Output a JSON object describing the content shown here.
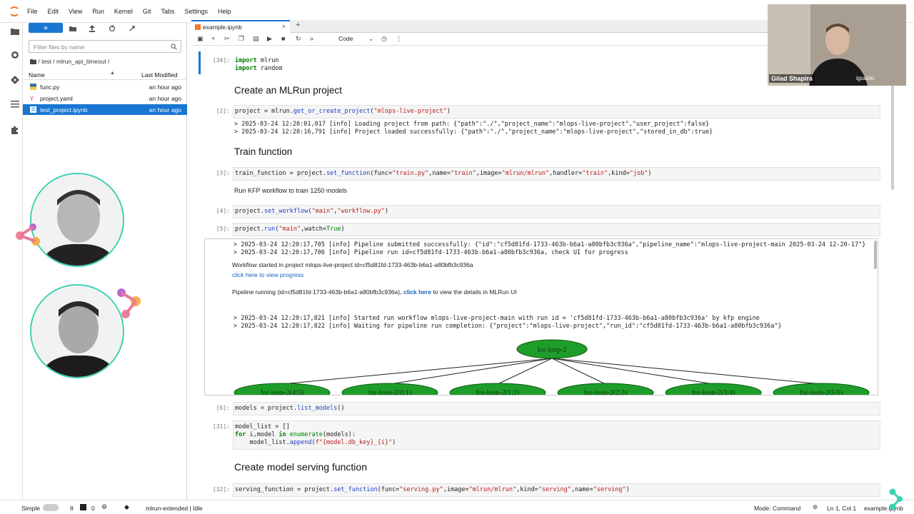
{
  "menu": [
    "File",
    "Edit",
    "View",
    "Run",
    "Kernel",
    "Git",
    "Tabs",
    "Settings",
    "Help"
  ],
  "filebrowser": {
    "new_label": "+",
    "filter_placeholder": "Filter files by name",
    "breadcrumb": "/ test / mlrun_api_timeout /",
    "col_name": "Name",
    "col_modified": "Last Modified",
    "files": [
      {
        "name": "func.py",
        "modified": "an hour ago",
        "selected": false
      },
      {
        "name": "project.yaml",
        "modified": "an hour ago",
        "selected": false
      },
      {
        "name": "test_project.ipynb",
        "modified": "an hour ago",
        "selected": true
      }
    ]
  },
  "tab": {
    "name": "example.ipynb",
    "close": "×",
    "add": "+"
  },
  "toolbar": {
    "cell_type": "Code"
  },
  "cells": {
    "c1_prompt": "[34]:",
    "c1_l1a": "import",
    "c1_l1b": " mlrun",
    "c1_l2a": "import",
    "c1_l2b": " random",
    "h1": "Create an MLRun project",
    "c2_prompt": "[2]:",
    "c2_a": "project = mlrun.",
    "c2_b": "get_or_create_project",
    "c2_c": "(",
    "c2_d": "\"mlops-live-project\"",
    "c2_e": ")",
    "c2_out1": "> 2025-03-24 12:20:01,017 [info] Loading project from path: {\"path\":\"./\",\"project_name\":\"mlops-live-project\",\"user_project\":false}",
    "c2_out2": "> 2025-03-24 12:20:16,791 [info] Project loaded successfully: {\"path\":\"./\",\"project_name\":\"mlops-live-project\",\"stored_in_db\":true}",
    "h2": "Train function",
    "c3_prompt": "[3]:",
    "c3_a": "train_function = project.",
    "c3_b": "set_function",
    "c3_c": "(func=",
    "c3_d": "\"train.py\"",
    "c3_e": ",name=",
    "c3_f": "\"train\"",
    "c3_g": ",image=",
    "c3_h": "\"mlrun/mlrun\"",
    "c3_i": ",handler=",
    "c3_j": "\"train\"",
    "c3_k": ",kind=",
    "c3_l": "\"job\"",
    "c3_m": ")",
    "p1": "Run KFP workflow to train 1250 models",
    "c4_prompt": "[4]:",
    "c4_a": "project.",
    "c4_b": "set_workflow",
    "c4_c": "(",
    "c4_d": "\"main\"",
    "c4_e": ",",
    "c4_f": "\"workflow.py\"",
    "c4_g": ")",
    "c5_prompt": "[5]:",
    "c5_a": "project.",
    "c5_b": "run",
    "c5_c": "(",
    "c5_d": "\"main\"",
    "c5_e": ",watch=",
    "c5_f": "True",
    "c5_g": ")",
    "c5_out1": "> 2025-03-24 12:20:17,705 [info] Pipeline submitted successfully: {\"id\":\"cf5d81fd-1733-463b-b6a1-a80bfb3c936a\",\"pipeline_name\":\"mlops-live-project-main 2025-03-24 12-20-17\"}",
    "c5_out2": "> 2025-03-24 12:20:17,706 [info] Pipeline run id=cf5d81fd-1733-463b-b6a1-a80bfb3c936a, check UI for progress",
    "c5_wf": "Workflow started in project mlops-live-project id=cf5d81fd-1733-463b-b6a1-a80bfb3c936a",
    "c5_link1": "click here to view progress",
    "c5_pr_a": "Pipeline running (id=cf5d81fd-1733-463b-b6a1-a80bfb3c936a), ",
    "c5_pr_b": "click here",
    "c5_pr_c": " to view the details in MLRun UI",
    "c5_out3": "> 2025-03-24 12:20:17,821 [info] Started run workflow mlops-live-project-main with run id = 'cf5d81fd-1733-463b-b6a1-a80bfb3c936a' by kfp engine",
    "c5_out4": "> 2025-03-24 12:20:17,822 [info] Waiting for pipeline run completion: {\"project\":\"mlops-live-project\",\"run_id\":\"cf5d81fd-1733-463b-b6a1-a80bfb3c936a\"}",
    "graph_root": "for-loop-2",
    "graph_children": [
      "for-loop-2(4:5)",
      "for-loop-2(0:1)",
      "for-loop-2(1:2)",
      "for-loop-2(2:3)",
      "for-loop-2(3:4)",
      "for-loop-2(5:6)"
    ],
    "c6_prompt": "[6]:",
    "c6_a": "models = project.",
    "c6_b": "list_models",
    "c6_c": "()",
    "c7_prompt": "[31]:",
    "c7_l1": "model_list = []",
    "c7_l2a": "for",
    "c7_l2b": " i,model ",
    "c7_l2c": "in",
    "c7_l2d": " ",
    "c7_l2e": "enumerate",
    "c7_l2f": "(models):",
    "c7_l3a": "    model_list.",
    "c7_l3b": "append",
    "c7_l3c": "(",
    "c7_l3d": "f\"{model.db_key}_{i}\"",
    "c7_l3e": ")",
    "h3": "Create model serving function",
    "c8_prompt": "[12]:",
    "c8_a": "serving_function = project.",
    "c8_b": "set_function",
    "c8_c": "(func=",
    "c8_d": "\"serving.py\"",
    "c8_e": ",image=",
    "c8_f": "\"mlrun/mlrun\"",
    "c8_g": ",kind=",
    "c8_h": "\"serving\"",
    "c8_i": ",name=",
    "c8_j": "\"serving\"",
    "c8_k": ")"
  },
  "status": {
    "simple": "Simple",
    "kernels": "8",
    "terminals": "0",
    "kernel_name": "mlrun-extended | Idle",
    "mode": "Mode: Command",
    "position": "Ln 1, Col 1",
    "file": "example.ipynb"
  },
  "video": {
    "participant": "Gilad Shapira",
    "brand": "iguazio"
  },
  "colors": {
    "accent": "#1976d2",
    "graph_node": "#1f9d2a",
    "avatar_ring": "#3ad1b0"
  }
}
